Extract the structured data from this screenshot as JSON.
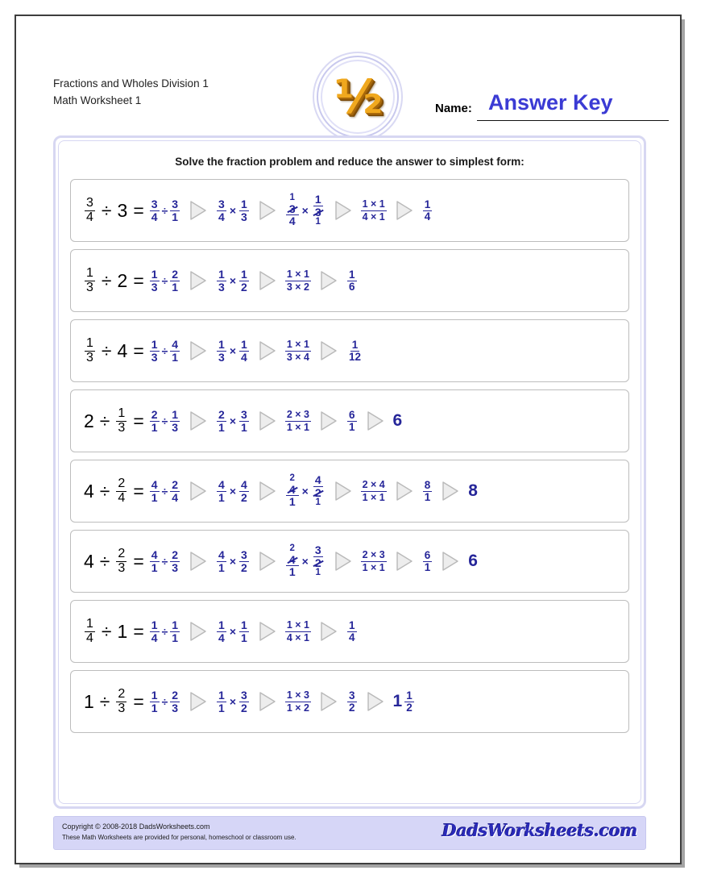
{
  "header": {
    "title_line1": "Fractions and Wholes Division 1",
    "title_line2": "Math Worksheet 1",
    "logo_glyph": "½",
    "name_label": "Name:",
    "name_value": "Answer Key"
  },
  "instructions": "Solve the fraction problem and reduce the answer to simplest form:",
  "colors": {
    "work_blue": "#262699",
    "answer_blue": "#3b3bd4",
    "panel_border": "#d7d7f2",
    "footer_bg": "#d6d6f7",
    "logo_gold": "#f0a81e"
  },
  "problems": [
    {
      "lead": {
        "type": "frac-div-whole",
        "num": "3",
        "den": "4",
        "op": "÷",
        "whole": "3",
        "eq": "="
      },
      "step_rewrite": {
        "a_num": "3",
        "a_den": "4",
        "op": "÷",
        "b_num": "3",
        "b_den": "1"
      },
      "step_reciprocal": {
        "a_num": "3",
        "a_den": "4",
        "op": "×",
        "b_num": "1",
        "b_den": "3"
      },
      "step_cancel": {
        "present": true,
        "a": {
          "num": "3",
          "num_struck": true,
          "num_replacement": "1",
          "replacement_pos": "above",
          "den": "4",
          "den_struck": false
        },
        "op": "×",
        "b": {
          "num": "1",
          "num_struck": false,
          "den": "3",
          "den_struck": true,
          "den_replacement": "1",
          "replacement_pos": "below"
        }
      },
      "step_product": {
        "num": "1 × 1",
        "den": "4 × 1"
      },
      "answer": {
        "type": "fraction",
        "num": "1",
        "den": "4"
      },
      "extra_answer": null
    },
    {
      "lead": {
        "type": "frac-div-whole",
        "num": "1",
        "den": "3",
        "op": "÷",
        "whole": "2",
        "eq": "="
      },
      "step_rewrite": {
        "a_num": "1",
        "a_den": "3",
        "op": "÷",
        "b_num": "2",
        "b_den": "1"
      },
      "step_reciprocal": {
        "a_num": "1",
        "a_den": "3",
        "op": "×",
        "b_num": "1",
        "b_den": "2"
      },
      "step_cancel": {
        "present": false
      },
      "step_product": {
        "num": "1 × 1",
        "den": "3 × 2"
      },
      "answer": {
        "type": "fraction",
        "num": "1",
        "den": "6"
      },
      "extra_answer": null
    },
    {
      "lead": {
        "type": "frac-div-whole",
        "num": "1",
        "den": "3",
        "op": "÷",
        "whole": "4",
        "eq": "="
      },
      "step_rewrite": {
        "a_num": "1",
        "a_den": "3",
        "op": "÷",
        "b_num": "4",
        "b_den": "1"
      },
      "step_reciprocal": {
        "a_num": "1",
        "a_den": "3",
        "op": "×",
        "b_num": "1",
        "b_den": "4"
      },
      "step_cancel": {
        "present": false
      },
      "step_product": {
        "num": "1 × 1",
        "den": "3 × 4"
      },
      "answer": {
        "type": "fraction",
        "num": "1",
        "den": "12"
      },
      "extra_answer": null
    },
    {
      "lead": {
        "type": "whole-div-frac",
        "whole": "2",
        "op": "÷",
        "num": "1",
        "den": "3",
        "eq": "="
      },
      "step_rewrite": {
        "a_num": "2",
        "a_den": "1",
        "op": "÷",
        "b_num": "1",
        "b_den": "3"
      },
      "step_reciprocal": {
        "a_num": "2",
        "a_den": "1",
        "op": "×",
        "b_num": "3",
        "b_den": "1"
      },
      "step_cancel": {
        "present": false
      },
      "step_product": {
        "num": "2 × 3",
        "den": "1 × 1"
      },
      "answer": {
        "type": "fraction",
        "num": "6",
        "den": "1"
      },
      "extra_answer": {
        "type": "whole",
        "value": "6"
      }
    },
    {
      "lead": {
        "type": "whole-div-frac",
        "whole": "4",
        "op": "÷",
        "num": "2",
        "den": "4",
        "eq": "="
      },
      "step_rewrite": {
        "a_num": "4",
        "a_den": "1",
        "op": "÷",
        "b_num": "2",
        "b_den": "4"
      },
      "step_reciprocal": {
        "a_num": "4",
        "a_den": "1",
        "op": "×",
        "b_num": "4",
        "b_den": "2"
      },
      "step_cancel": {
        "present": true,
        "a": {
          "num": "4",
          "num_struck": true,
          "num_replacement": "2",
          "replacement_pos": "above",
          "den": "1",
          "den_struck": false
        },
        "op": "×",
        "b": {
          "num": "4",
          "num_struck": false,
          "den": "2",
          "den_struck": true,
          "den_replacement": "1",
          "replacement_pos": "below"
        }
      },
      "step_product": {
        "num": "2 × 4",
        "den": "1 × 1"
      },
      "answer": {
        "type": "fraction",
        "num": "8",
        "den": "1"
      },
      "extra_answer": {
        "type": "whole",
        "value": "8"
      }
    },
    {
      "lead": {
        "type": "whole-div-frac",
        "whole": "4",
        "op": "÷",
        "num": "2",
        "den": "3",
        "eq": "="
      },
      "step_rewrite": {
        "a_num": "4",
        "a_den": "1",
        "op": "÷",
        "b_num": "2",
        "b_den": "3"
      },
      "step_reciprocal": {
        "a_num": "4",
        "a_den": "1",
        "op": "×",
        "b_num": "3",
        "b_den": "2"
      },
      "step_cancel": {
        "present": true,
        "a": {
          "num": "4",
          "num_struck": true,
          "num_replacement": "2",
          "replacement_pos": "above",
          "den": "1",
          "den_struck": false
        },
        "op": "×",
        "b": {
          "num": "3",
          "num_struck": false,
          "den": "2",
          "den_struck": true,
          "den_replacement": "1",
          "replacement_pos": "below"
        }
      },
      "step_product": {
        "num": "2 × 3",
        "den": "1 × 1"
      },
      "answer": {
        "type": "fraction",
        "num": "6",
        "den": "1"
      },
      "extra_answer": {
        "type": "whole",
        "value": "6"
      }
    },
    {
      "lead": {
        "type": "frac-div-whole",
        "num": "1",
        "den": "4",
        "op": "÷",
        "whole": "1",
        "eq": "="
      },
      "step_rewrite": {
        "a_num": "1",
        "a_den": "4",
        "op": "÷",
        "b_num": "1",
        "b_den": "1"
      },
      "step_reciprocal": {
        "a_num": "1",
        "a_den": "4",
        "op": "×",
        "b_num": "1",
        "b_den": "1"
      },
      "step_cancel": {
        "present": false
      },
      "step_product": {
        "num": "1 × 1",
        "den": "4 × 1"
      },
      "answer": {
        "type": "fraction",
        "num": "1",
        "den": "4"
      },
      "extra_answer": null
    },
    {
      "lead": {
        "type": "whole-div-frac",
        "whole": "1",
        "op": "÷",
        "num": "2",
        "den": "3",
        "eq": "="
      },
      "step_rewrite": {
        "a_num": "1",
        "a_den": "1",
        "op": "÷",
        "b_num": "2",
        "b_den": "3"
      },
      "step_reciprocal": {
        "a_num": "1",
        "a_den": "1",
        "op": "×",
        "b_num": "3",
        "b_den": "2"
      },
      "step_cancel": {
        "present": false
      },
      "step_product": {
        "num": "1 × 3",
        "den": "1 × 2"
      },
      "answer": {
        "type": "fraction",
        "num": "3",
        "den": "2"
      },
      "extra_answer": {
        "type": "mixed",
        "whole": "1",
        "num": "1",
        "den": "2"
      }
    }
  ],
  "footer": {
    "copyright": "Copyright © 2008-2018 DadsWorksheets.com",
    "usage": "These Math Worksheets are provided for personal, homeschool or classroom use.",
    "brand": "DadsWorksheets.com"
  }
}
